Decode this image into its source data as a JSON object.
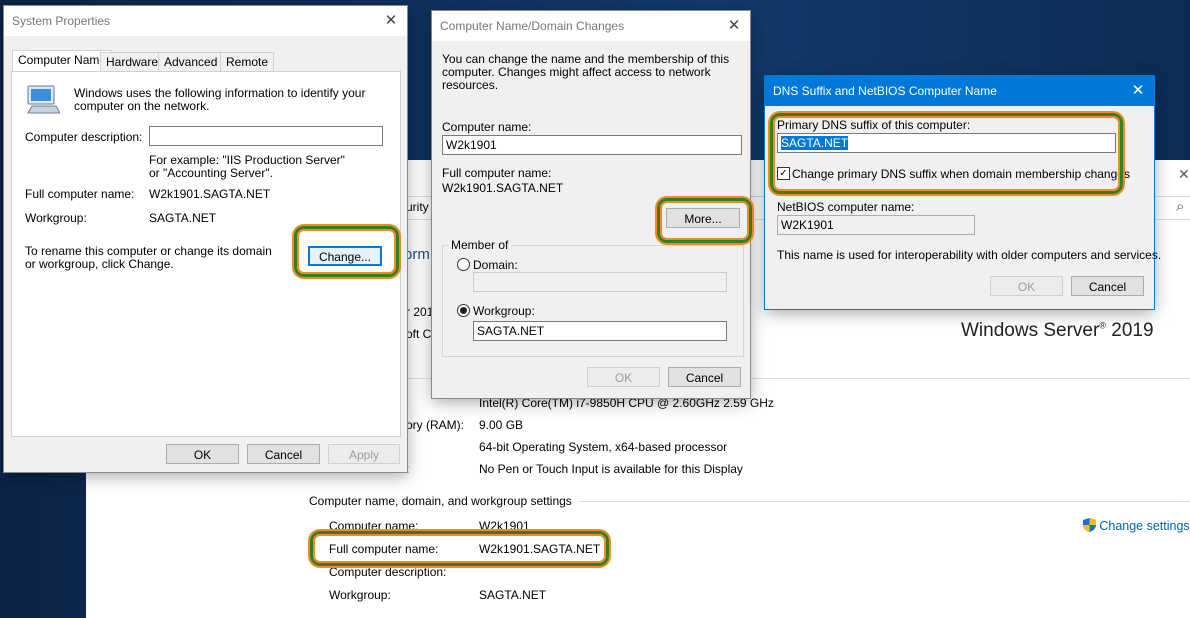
{
  "system_page": {
    "partial_security": "urity",
    "partial_info": "orm",
    "partial_year": "r 201",
    "partial_microsoft": "oft C",
    "windows_brand": "Windows Server",
    "windows_sup": "®",
    "windows_version": "2019",
    "processor_value": "Intel(R) Core(TM) i7-9850H CPU @ 2.60GHz   2.59 GHz",
    "ram_label_partial": "ory (RAM):",
    "ram_value": "9.00 GB",
    "system_type_value": "64-bit Operating System, x64-based processor",
    "pen_label_partial": ":",
    "pen_value": "No Pen or Touch Input is available for this Display",
    "section_title": "Computer name, domain, and workgroup settings",
    "computer_name_label": "Computer name:",
    "computer_name_value": "W2k1901",
    "full_name_label": "Full computer name:",
    "full_name_value": "W2k1901.SAGTA.NET",
    "description_label": "Computer description:",
    "workgroup_label": "Workgroup:",
    "workgroup_value": "SAGTA.NET",
    "change_settings_link": "Change settings"
  },
  "system_properties": {
    "title": "System Properties",
    "tabs": [
      "Computer Name",
      "Hardware",
      "Advanced",
      "Remote"
    ],
    "intro": "Windows uses the following information to identify your computer on the network.",
    "description_label": "Computer description:",
    "description_value": "",
    "example_text": "For example: \"IIS Production Server\" or \"Accounting Server\".",
    "full_name_label": "Full computer name:",
    "full_name_value": "W2k1901.SAGTA.NET",
    "workgroup_label": "Workgroup:",
    "workgroup_value": "SAGTA.NET",
    "rename_text": "To rename this computer or change its domain or workgroup, click Change.",
    "change_button": "Change...",
    "ok_button": "OK",
    "cancel_button": "Cancel",
    "apply_button": "Apply"
  },
  "name_changes": {
    "title": "Computer Name/Domain Changes",
    "intro": "You can change the name and the membership of this computer. Changes might affect access to network resources.",
    "computer_name_label": "Computer name:",
    "computer_name_value": "W2k1901",
    "full_name_label": "Full computer name:",
    "full_name_value": "W2k1901.SAGTA.NET",
    "more_button": "More...",
    "member_of_label": "Member of",
    "domain_label": "Domain:",
    "domain_value": "",
    "workgroup_label": "Workgroup:",
    "workgroup_value": "SAGTA.NET",
    "ok_button": "OK",
    "cancel_button": "Cancel"
  },
  "dns_suffix": {
    "title": "DNS Suffix and NetBIOS Computer Name",
    "primary_label": "Primary DNS suffix of this computer:",
    "primary_value": "SAGTA.NET",
    "checkbox_label": "Change primary DNS suffix when domain membership changes",
    "checkbox_mark": "✓",
    "netbios_label": "NetBIOS computer name:",
    "netbios_value": "W2K1901",
    "note": "This name is used for interoperability with older computers and services.",
    "ok_button": "OK",
    "cancel_button": "Cancel"
  },
  "icons": {
    "close": "✕",
    "search": "⌕",
    "shield": "shield-icon"
  },
  "colors": {
    "highlight_outer": "#3a7d1e",
    "highlight_inner": "#f08a24",
    "dns_titlebar": "#0078d7",
    "link": "#0063b1"
  }
}
